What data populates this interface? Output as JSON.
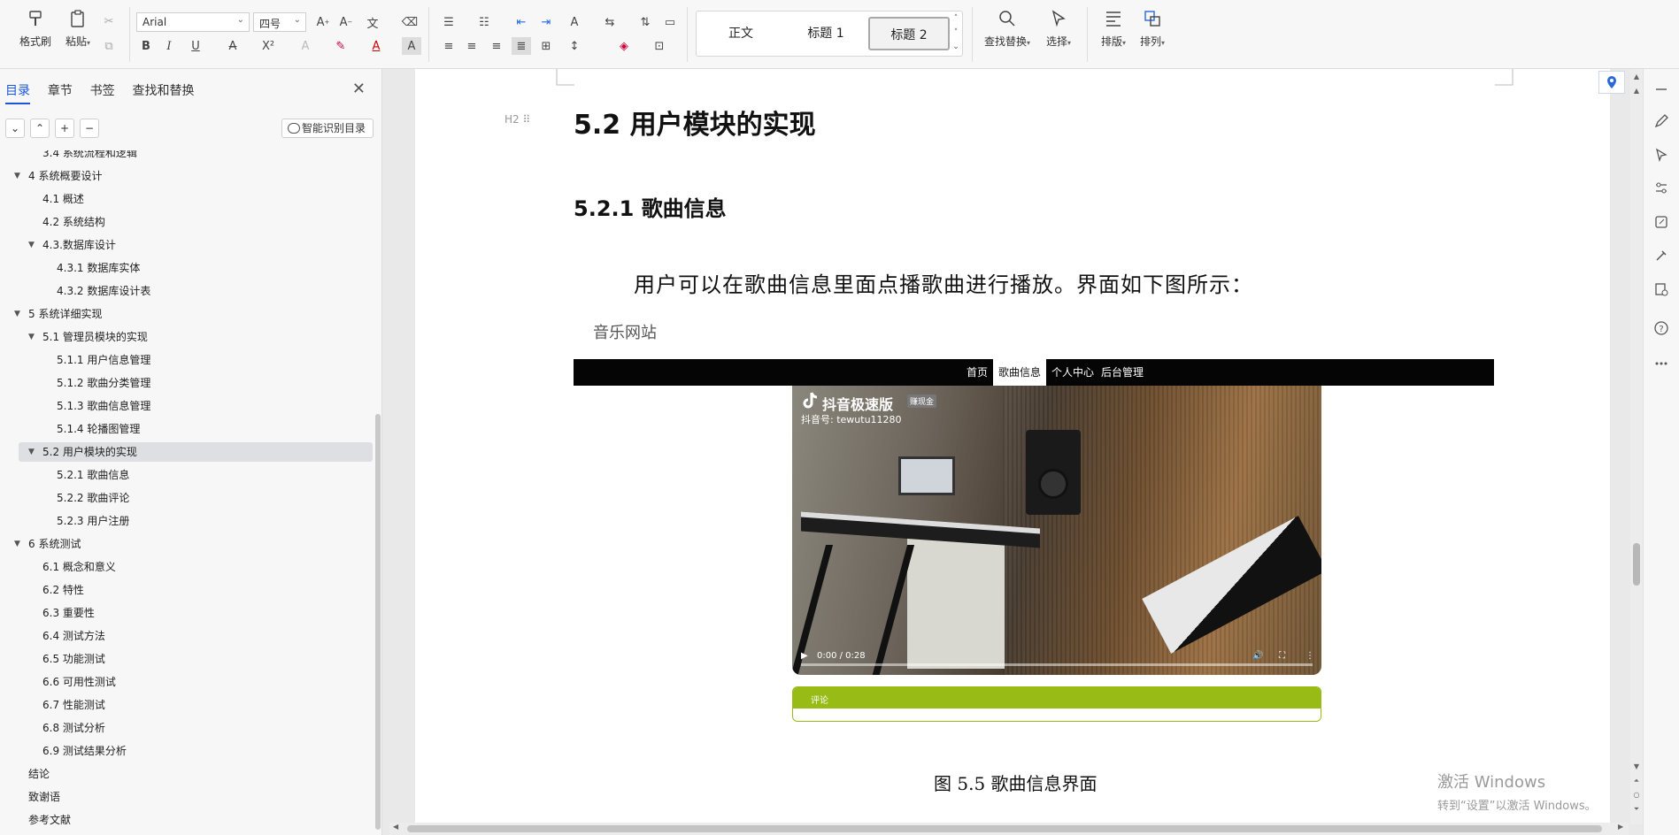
{
  "toolbar": {
    "format_painter": "格式刷",
    "paste": "粘贴",
    "font_name": "Arial",
    "font_size": "四号",
    "styles": [
      "正文",
      "标题 1",
      "标题 2"
    ],
    "active_style": "标题 2",
    "find_replace": "查找替换",
    "select": "选择",
    "layout": "排版",
    "arrange": "排列"
  },
  "nav": {
    "tabs": [
      "目录",
      "章节",
      "书签",
      "查找和替换"
    ],
    "active_tab": "目录",
    "smart_button": "智能识别目录",
    "items": [
      {
        "label": "3.4 系统流程和逻辑",
        "level": 2,
        "toggle": ""
      },
      {
        "label": "4 系统概要设计",
        "level": 1,
        "toggle": "▼"
      },
      {
        "label": "4.1 概述",
        "level": 2,
        "toggle": ""
      },
      {
        "label": "4.2 系统结构",
        "level": 2,
        "toggle": ""
      },
      {
        "label": "4.3.数据库设计",
        "level": 2,
        "toggle": "▼"
      },
      {
        "label": "4.3.1 数据库实体",
        "level": 3,
        "toggle": ""
      },
      {
        "label": "4.3.2 数据库设计表",
        "level": 3,
        "toggle": ""
      },
      {
        "label": "5 系统详细实现",
        "level": 1,
        "toggle": "▼"
      },
      {
        "label": "5.1  管理员模块的实现",
        "level": 2,
        "toggle": "▼"
      },
      {
        "label": "5.1.1  用户信息管理",
        "level": 3,
        "toggle": ""
      },
      {
        "label": "5.1.2  歌曲分类管理",
        "level": 3,
        "toggle": ""
      },
      {
        "label": "5.1.3  歌曲信息管理",
        "level": 3,
        "toggle": ""
      },
      {
        "label": "5.1.4  轮播图管理",
        "level": 3,
        "toggle": ""
      },
      {
        "label": "5.2  用户模块的实现",
        "level": 2,
        "toggle": "▼",
        "selected": true
      },
      {
        "label": "5.2.1  歌曲信息",
        "level": 3,
        "toggle": ""
      },
      {
        "label": "5.2.2  歌曲评论",
        "level": 3,
        "toggle": ""
      },
      {
        "label": "5.2.3  用户注册",
        "level": 3,
        "toggle": ""
      },
      {
        "label": "6 系统测试",
        "level": 1,
        "toggle": "▼"
      },
      {
        "label": "6.1 概念和意义",
        "level": 2,
        "toggle": ""
      },
      {
        "label": "6.2 特性",
        "level": 2,
        "toggle": ""
      },
      {
        "label": "6.3 重要性",
        "level": 2,
        "toggle": ""
      },
      {
        "label": "6.4 测试方法",
        "level": 2,
        "toggle": ""
      },
      {
        "label": "6.5  功能测试",
        "level": 2,
        "toggle": ""
      },
      {
        "label": "6.6 可用性测试",
        "level": 2,
        "toggle": ""
      },
      {
        "label": "6.7 性能测试",
        "level": 2,
        "toggle": ""
      },
      {
        "label": "6.8 测试分析",
        "level": 2,
        "toggle": ""
      },
      {
        "label": "6.9 测试结果分析",
        "level": 2,
        "toggle": ""
      },
      {
        "label": "结论",
        "level": 1,
        "toggle": ""
      },
      {
        "label": "致谢语",
        "level": 1,
        "toggle": ""
      },
      {
        "label": "参考文献",
        "level": 1,
        "toggle": ""
      }
    ]
  },
  "doc": {
    "h2_marker": "H2",
    "heading2": "5.2  用户模块的实现",
    "heading3": "5.2.1  歌曲信息",
    "paragraph": "用户可以在歌曲信息里面点播歌曲进行播放。界面如下图所示：",
    "screenshot": {
      "site_title": "音乐网站",
      "nav_items": [
        "首页",
        "歌曲信息",
        "个人中心",
        "后台管理"
      ],
      "active_nav": "歌曲信息",
      "video_brand": "抖音极速版",
      "video_badge": "赚现金",
      "video_account": "抖音号: tewutu11280",
      "video_time": "0:00 / 0:28",
      "video_progress": 0,
      "comment_title": "评论"
    },
    "caption": "图 5.5  歌曲信息界面"
  },
  "watermark": {
    "line1": "激活 Windows",
    "line2": "转到“设置”以激活 Windows。"
  }
}
